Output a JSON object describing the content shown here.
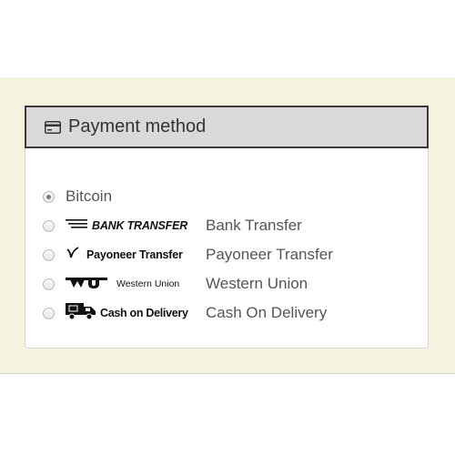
{
  "panel": {
    "title": "Payment method",
    "icon": "credit-card-icon"
  },
  "payment_options": [
    {
      "label": "Bitcoin",
      "selected": true,
      "logo_text": ""
    },
    {
      "label": "Bank Transfer",
      "selected": false,
      "logo_text": "BANK TRANSFER",
      "icon": "bank-transfer-lines-icon"
    },
    {
      "label": "Payoneer Transfer",
      "selected": false,
      "logo_text": "Payoneer Transfer",
      "icon": "payoneer-swoosh-icon"
    },
    {
      "label": "Western Union",
      "selected": false,
      "logo_text": "Western Union",
      "icon": "western-union-wu-icon"
    },
    {
      "label": "Cash On Delivery",
      "selected": false,
      "logo_text": "Cash on Delivery",
      "icon": "delivery-truck-icon"
    }
  ],
  "colors": {
    "band_background": "#f5f3e0",
    "heading_background": "#d9d9d9",
    "heading_border": "#3a3a3a",
    "label_text": "#555555"
  }
}
